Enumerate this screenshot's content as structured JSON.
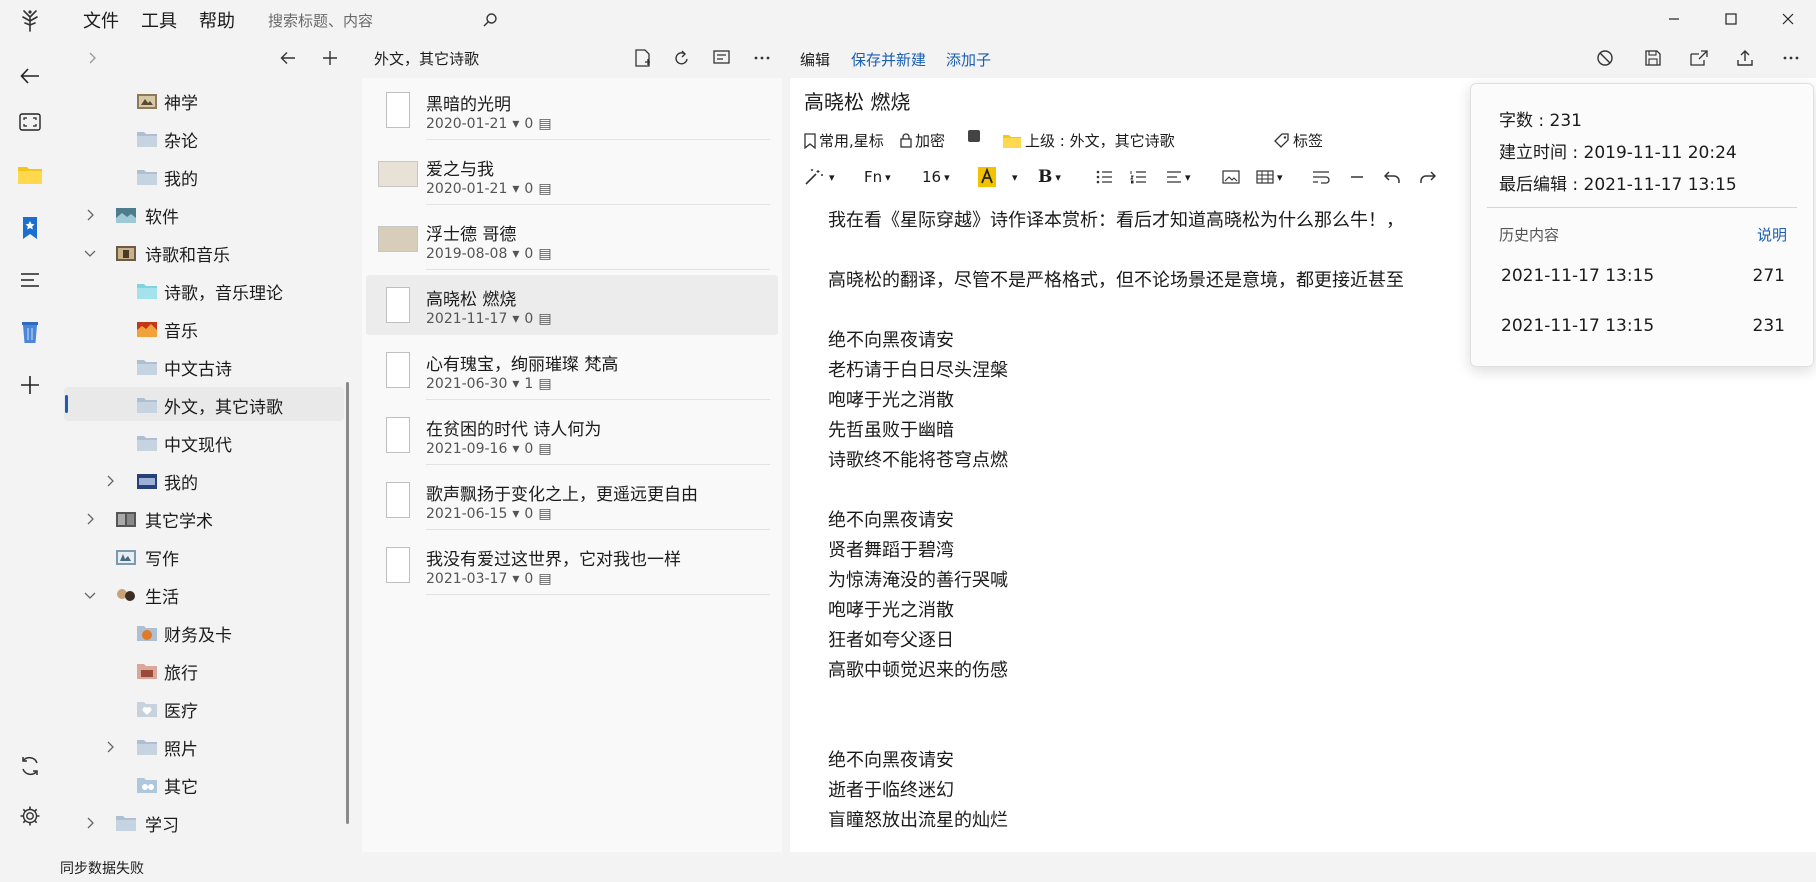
{
  "menu": {
    "file": "文件",
    "tools": "工具",
    "help": "帮助"
  },
  "search": {
    "placeholder": "搜索标题、内容"
  },
  "folders": {
    "items": [
      {
        "label": "神学"
      },
      {
        "label": "杂论"
      },
      {
        "label": "我的"
      },
      {
        "label": "软件"
      },
      {
        "label": "诗歌和音乐"
      },
      {
        "label": "诗歌，音乐理论"
      },
      {
        "label": "音乐"
      },
      {
        "label": "中文古诗"
      },
      {
        "label": "外文，其它诗歌"
      },
      {
        "label": "中文现代"
      },
      {
        "label": "我的"
      },
      {
        "label": "其它学术"
      },
      {
        "label": "写作"
      },
      {
        "label": "生活"
      },
      {
        "label": "财务及卡"
      },
      {
        "label": "旅行"
      },
      {
        "label": "医疗"
      },
      {
        "label": "照片"
      },
      {
        "label": "其它"
      },
      {
        "label": "学习"
      }
    ]
  },
  "notelist": {
    "folder_title": "外文，其它诗歌",
    "notes": [
      {
        "title": "黑暗的光明",
        "date": "2020-01-21",
        "count": "0"
      },
      {
        "title": "爱之与我",
        "date": "2020-01-21",
        "count": "0"
      },
      {
        "title": "浮士德  哥德",
        "date": "2019-08-08",
        "count": "0"
      },
      {
        "title": "高晓松  燃烧",
        "date": "2021-11-17",
        "count": "0"
      },
      {
        "title": "心有瑰宝，绚丽璀璨  梵高",
        "date": "2021-06-30",
        "count": "1"
      },
      {
        "title": "在贫困的时代 诗人何为",
        "date": "2021-09-16",
        "count": "0"
      },
      {
        "title": "歌声飘扬于变化之上，更遥远更自由",
        "date": "2021-06-15",
        "count": "0"
      },
      {
        "title": "我没有爱过这世界，它对我也一样",
        "date": "2021-03-17",
        "count": "0"
      }
    ]
  },
  "editor": {
    "edit": "编辑",
    "save_new": "保存并新建",
    "add_child": "添加子",
    "title": "高晓松  燃烧",
    "props": {
      "star": "常用,星标",
      "encrypt": "加密",
      "parent": "上级 : 外文，其它诗歌",
      "tags": "标签"
    },
    "fmt": {
      "font": "Fn",
      "size": "16"
    },
    "content": [
      "我在看《星际穿越》诗作译本赏析：看后才知道高晓松为什么那么牛！，",
      "",
      "高晓松的翻译，尽管不是严格格式，但不论场景还是意境，都更接近甚至",
      "",
      "绝不向黑夜请安",
      "老朽请于白日尽头涅槃",
      "咆哮于光之消散",
      "先哲虽败于幽暗",
      "诗歌终不能将苍穹点燃",
      "",
      "绝不向黑夜请安",
      "贤者舞蹈于碧湾",
      "为惊涛淹没的善行哭喊",
      "咆哮于光之消散",
      "狂者如夸父逐日",
      "高歌中顿觉迟来的伤感",
      "",
      "",
      "绝不向黑夜请安",
      "逝者于临终迷幻",
      "盲瞳怒放出流星的灿烂"
    ]
  },
  "info": {
    "words": "字数 : 231",
    "created": "建立时间 : 2019-11-11 20:24",
    "modified": "最后编辑 : 2021-11-17 13:15",
    "history_label": "历史内容",
    "help": "说明",
    "history": [
      {
        "time": "2021-11-17 13:15",
        "count": "271"
      },
      {
        "time": "2021-11-17 13:15",
        "count": "231"
      }
    ]
  },
  "status": {
    "text": "同步数据失败"
  },
  "colors": {
    "accent": "#1a5fb4",
    "folder": "#b9c7d6",
    "star": "#1a5fb4",
    "highlight": "#f2c200"
  }
}
